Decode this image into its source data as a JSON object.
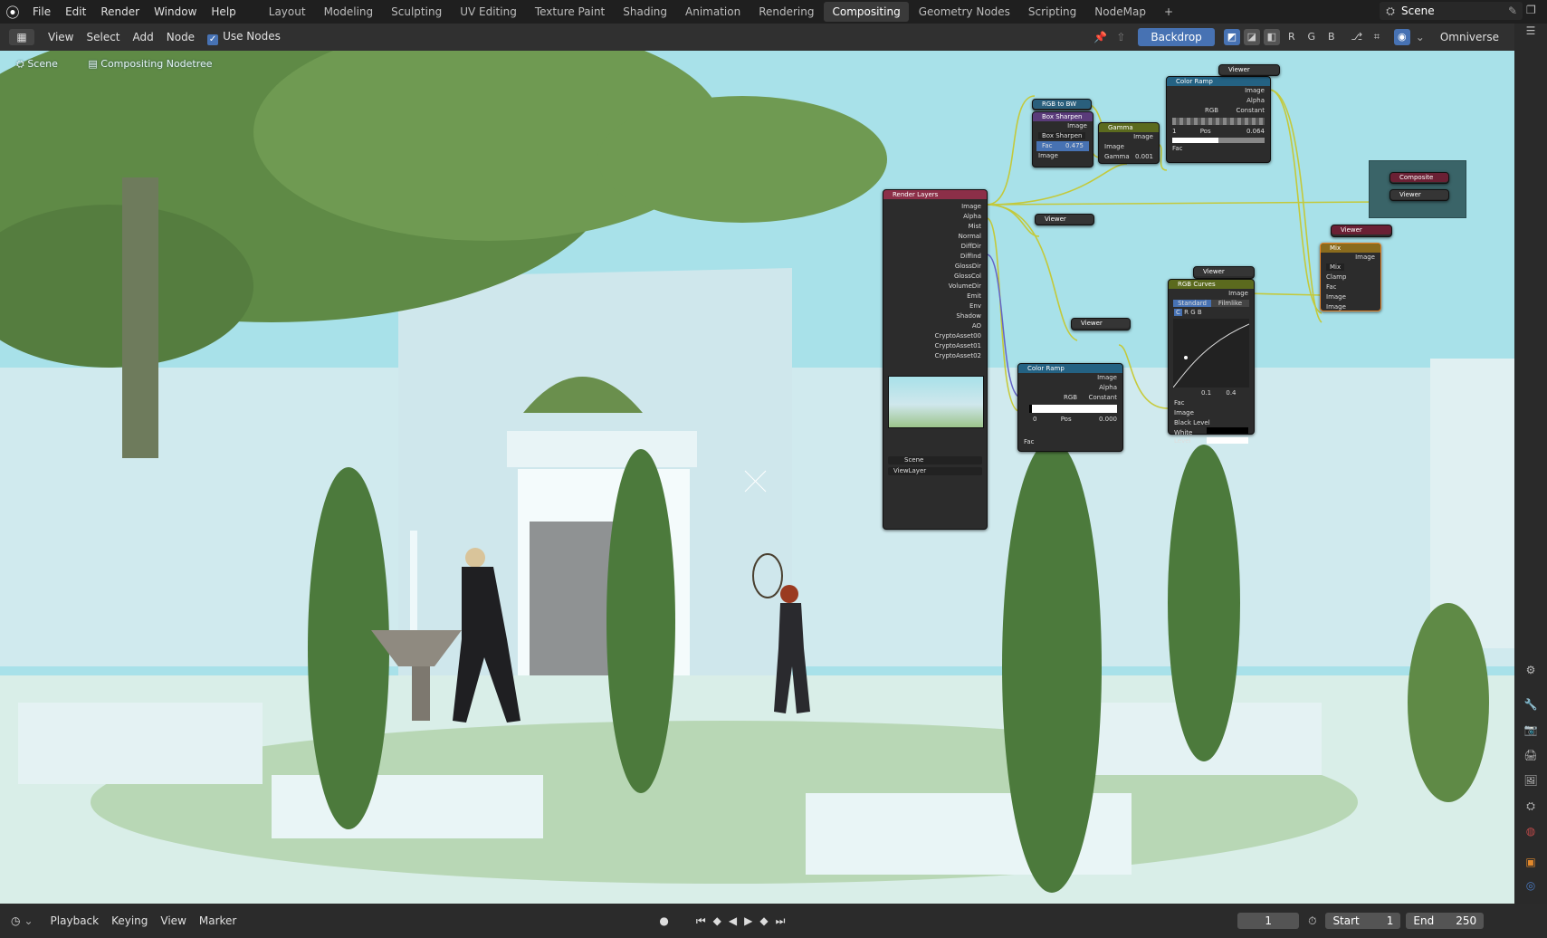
{
  "topbar": {
    "menus": [
      "File",
      "Edit",
      "Render",
      "Window",
      "Help"
    ],
    "workspaces": [
      "Layout",
      "Modeling",
      "Sculpting",
      "UV Editing",
      "Texture Paint",
      "Shading",
      "Animation",
      "Rendering",
      "Compositing",
      "Geometry Nodes",
      "Scripting",
      "NodeMap"
    ],
    "active_workspace": "Compositing",
    "add_tab": "+",
    "scene_name": "Scene"
  },
  "editor_header": {
    "menus": [
      "View",
      "Select",
      "Add",
      "Node"
    ],
    "use_nodes_label": "Use Nodes",
    "backdrop_label": "Backdrop",
    "channel_buttons": [
      "R",
      "G",
      "B"
    ],
    "engine_label": "Omniverse"
  },
  "breadcrumb": {
    "scene": "Scene",
    "tree": "Compositing Nodetree"
  },
  "nodes": {
    "render_layers": {
      "title": "Render Layers",
      "outputs": [
        "Image",
        "Alpha",
        "Mist",
        "Normal",
        "DiffDir",
        "DiffInd",
        "GlossDir",
        "GlossCol",
        "VolumeDir",
        "Emit",
        "Env",
        "Shadow",
        "AO",
        "CryptoAsset00",
        "CryptoAsset01",
        "CryptoAsset02"
      ],
      "scene": "Scene",
      "view_layer": "ViewLayer"
    },
    "rgb_to_bw": {
      "title": "RGB to BW"
    },
    "box_sharpen": {
      "title": "Box Sharpen",
      "type": "Box Sharpen",
      "fac_label": "Fac",
      "fac_value": "0.475",
      "image": "Image"
    },
    "gamma": {
      "title": "Gamma",
      "image": "Image",
      "gamma_label": "Gamma",
      "gamma_value": "0.001"
    },
    "color_ramp_top": {
      "title": "Color Ramp",
      "image": "Image",
      "alpha": "Alpha",
      "mode": "RGB",
      "interp": "Constant",
      "pos_index": "1",
      "pos_label": "Pos",
      "pos_value": "0.064",
      "fac": "Fac"
    },
    "viewer_top": {
      "title": "Viewer"
    },
    "composite_frame": {
      "composite": "Composite",
      "viewer": "Viewer"
    },
    "viewer_mid": {
      "title": "Viewer"
    },
    "viewer_right": {
      "title": "Viewer"
    },
    "mix": {
      "title": "Mix",
      "image": "Image",
      "blend": "Mix",
      "clamp": "Clamp",
      "fac": "Fac",
      "in1": "Image",
      "in2": "Image"
    },
    "viewer_curves": {
      "title": "Viewer"
    },
    "rgb_curves": {
      "title": "RGB Curves",
      "image": "Image",
      "tab_standard": "Standard",
      "tab_filmlike": "Filmlike",
      "channels": [
        "C",
        "R",
        "G",
        "B"
      ],
      "x_value": "0.1",
      "y_value": "0.4",
      "fac": "Fac",
      "img": "Image",
      "black": "Black Level",
      "white": "White Level"
    },
    "viewer_ramp2": {
      "title": "Viewer"
    },
    "color_ramp_2": {
      "title": "Color Ramp",
      "image": "Image",
      "alpha": "Alpha",
      "mode": "RGB",
      "interp": "Constant",
      "pos_index": "0",
      "pos_label": "Pos",
      "pos_value": "0.000",
      "fac": "Fac"
    }
  },
  "timeline": {
    "menus": [
      "Playback",
      "Keying",
      "View",
      "Marker"
    ],
    "current_frame": "1",
    "start_label": "Start",
    "start_value": "1",
    "end_label": "End",
    "end_value": "250"
  },
  "colors": {
    "accent": "#4772b3",
    "header_render_layers": "#8c2f48",
    "header_color_ramp": "#246283",
    "header_gamma": "#5b6a1e",
    "header_rgb_curves": "#5b6a1e",
    "header_mix": "#8a6b1d",
    "header_viewer": "#353535",
    "wire": "#c7c729"
  }
}
